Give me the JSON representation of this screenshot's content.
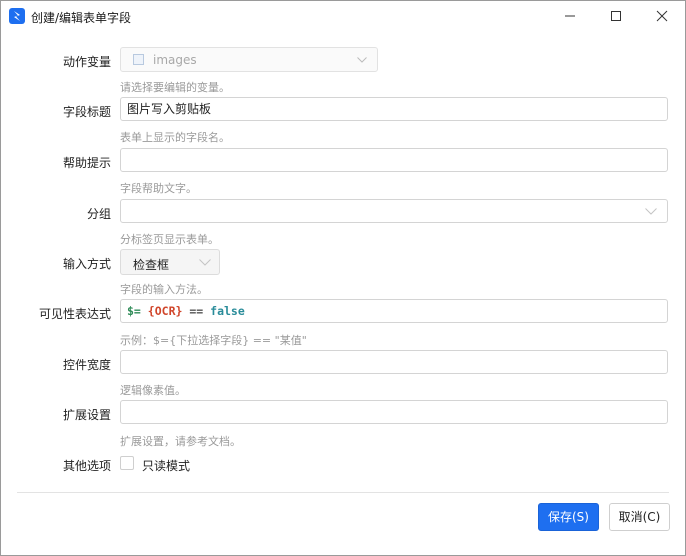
{
  "window": {
    "title": "创建/编辑表单字段"
  },
  "fields": {
    "action_variable": {
      "label": "动作变量",
      "value": "images",
      "hint": "请选择要编辑的变量。"
    },
    "field_title": {
      "label": "字段标题",
      "value": "图片写入剪贴板",
      "hint": "表单上显示的字段名。"
    },
    "help_tip": {
      "label": "帮助提示",
      "value": "",
      "hint": "字段帮助文字。"
    },
    "group": {
      "label": "分组",
      "value": "",
      "hint": "分标签页显示表单。"
    },
    "input_mode": {
      "label": "输入方式",
      "value": "检查框",
      "hint": "字段的输入方法。"
    },
    "visibility_expr": {
      "label": "可见性表达式",
      "tokens": {
        "var": "$=",
        "ref": "{OCR}",
        "op": "==",
        "kw": "false"
      },
      "hint": "示例：$={下拉选择字段} == \"某值\""
    },
    "control_width": {
      "label": "控件宽度",
      "value": "",
      "hint": "逻辑像素值。"
    },
    "ext_settings": {
      "label": "扩展设置",
      "value": "",
      "hint": "扩展设置，请参考文档。"
    },
    "other_options": {
      "label": "其他选项",
      "readonly_label": "只读模式",
      "readonly_checked": false
    }
  },
  "buttons": {
    "save": "保存(S)",
    "cancel": "取消(C)"
  },
  "colors": {
    "accent": "#1e6ff0",
    "hint": "#9a9a9a"
  }
}
